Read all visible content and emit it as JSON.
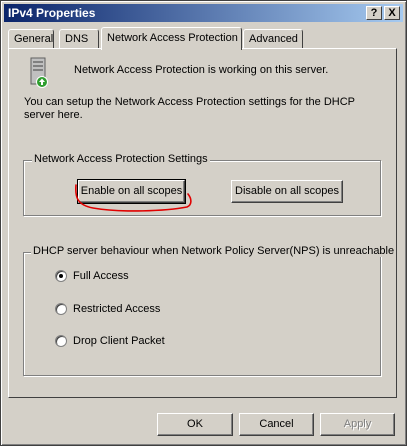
{
  "window": {
    "title": "IPv4 Properties",
    "help_button": "?",
    "close_button": "X"
  },
  "tabs": [
    {
      "label": "General",
      "active": false
    },
    {
      "label": "DNS",
      "active": false
    },
    {
      "label": "Network Access Protection",
      "active": true
    },
    {
      "label": "Advanced",
      "active": false
    }
  ],
  "nap": {
    "status_text": "Network Access Protection is working on this server.",
    "description": "You can setup the Network Access Protection settings for the DHCP server here.",
    "settings_group": {
      "label": "Network Access Protection Settings",
      "enable_button": "Enable on all scopes",
      "disable_button": "Disable on all scopes"
    },
    "unreachable_group": {
      "label": "DHCP server behaviour when Network Policy Server(NPS) is unreachable",
      "options": [
        {
          "label": "Full Access",
          "selected": true
        },
        {
          "label": "Restricted Access",
          "selected": false
        },
        {
          "label": "Drop Client Packet",
          "selected": false
        }
      ]
    }
  },
  "footer": {
    "ok": "OK",
    "cancel": "Cancel",
    "apply": "Apply"
  },
  "colors": {
    "face": "#d4d0c8",
    "title_start": "#0a246a",
    "title_end": "#a6caf0",
    "annotation": "#e00000"
  }
}
